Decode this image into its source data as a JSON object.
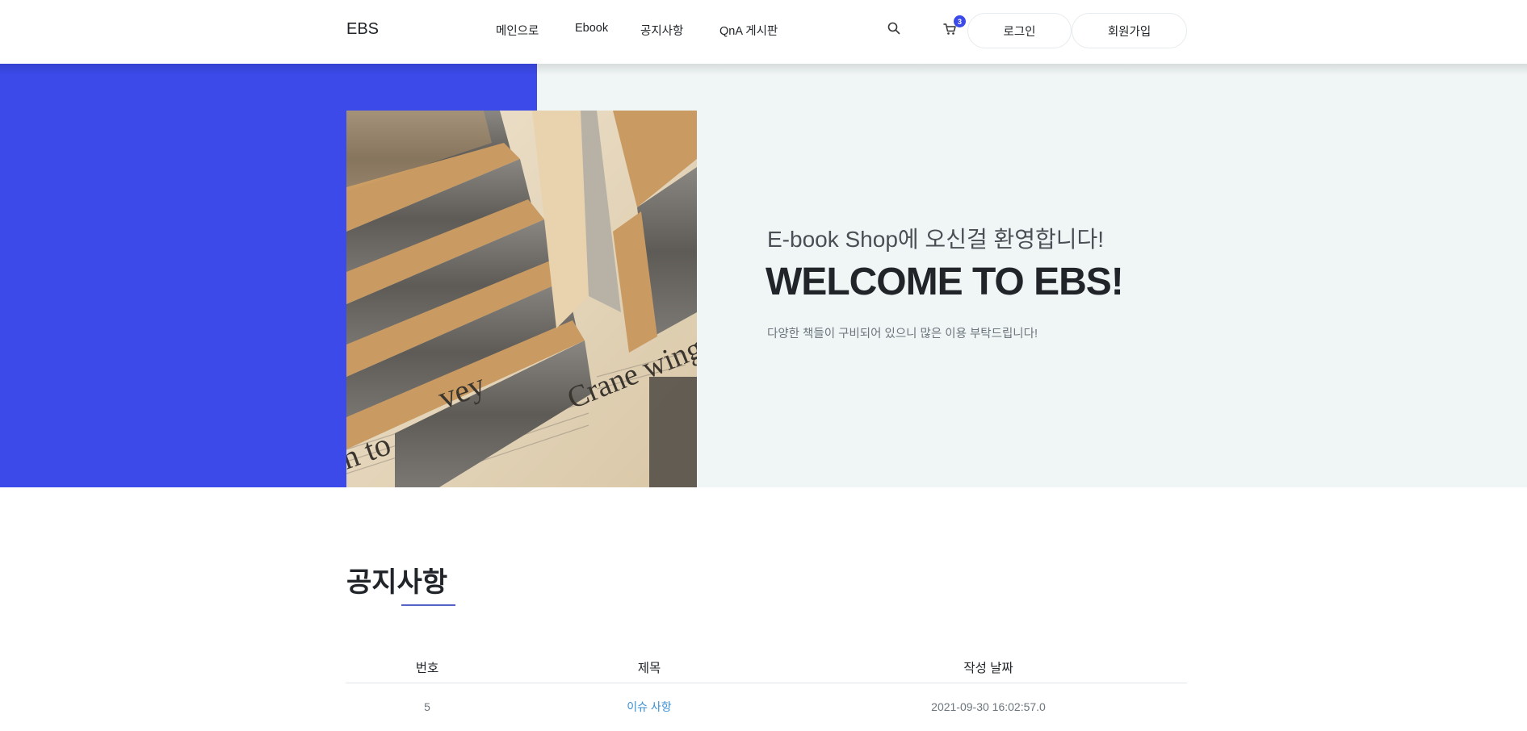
{
  "header": {
    "brand": "EBS",
    "nav": [
      {
        "label": "메인으로"
      },
      {
        "label": "Ebook"
      },
      {
        "label": "공지사항"
      },
      {
        "label": "QnA 게시판"
      }
    ],
    "icons": {
      "search": "search-icon",
      "cart": "cart-icon"
    },
    "cart_count": "3",
    "login_label": "로그인",
    "signup_label": "회원가입"
  },
  "hero": {
    "subtitle": "E-book Shop에 오신걸 환영합니다!",
    "title": "WELCOME TO EBS!",
    "description": "다양한 책들이 구비되어 있으니 많은 이용 부탁드립니다!",
    "image_description": "stacked books on newspaper",
    "colors": {
      "accent": "#3b4ae8",
      "background": "#f0f5f5"
    }
  },
  "notice": {
    "title": "공지사항",
    "columns": [
      "번호",
      "제목",
      "작성 날짜"
    ],
    "rows": [
      {
        "number": "5",
        "title": "이슈 사항",
        "date": "2021-09-30 16:02:57.0"
      }
    ]
  }
}
